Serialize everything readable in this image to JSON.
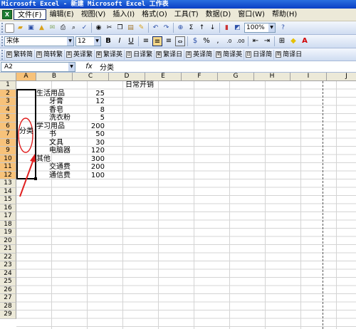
{
  "window": {
    "title": "Microsoft Excel - 新建 Microsoft Excel 工作表"
  },
  "menu": {
    "app_icon": "excel-icon",
    "items": [
      "文件(F)",
      "编辑(E)",
      "视图(V)",
      "插入(I)",
      "格式(O)",
      "工具(T)",
      "数据(D)",
      "窗口(W)",
      "帮助(H)"
    ]
  },
  "toolbar": {
    "zoom": "100%",
    "sum_icon": "Σ"
  },
  "format_toolbar": {
    "font": "宋体",
    "size": "12",
    "bold": "B",
    "italic": "I",
    "underline": "U",
    "percent": "%"
  },
  "translate_toolbar": {
    "items": [
      "繁转简",
      "简转繁",
      "英译繁",
      "繁译英",
      "日译繁",
      "繁译日",
      "英译简",
      "简译英",
      "日译简",
      "简译日"
    ]
  },
  "formula_bar": {
    "name_box": "A2",
    "fx": "fx",
    "value": "分类"
  },
  "grid": {
    "columns": [
      "A",
      "B",
      "C",
      "D",
      "E",
      "F",
      "G",
      "H",
      "I",
      "J"
    ],
    "rows": [
      "1",
      "2",
      "3",
      "4",
      "5",
      "6",
      "7",
      "8",
      "9",
      "10",
      "11",
      "12",
      "13",
      "14",
      "15",
      "16",
      "17",
      "18",
      "19",
      "20",
      "21",
      "22",
      "23",
      "24",
      "25",
      "26",
      "27",
      "28",
      "29"
    ],
    "selected_col": "A",
    "selected_rows": [
      "2",
      "3",
      "4",
      "5",
      "6",
      "7",
      "8",
      "9",
      "10",
      "11",
      "12"
    ]
  },
  "sheet": {
    "header": "日常开销",
    "merged_a": "分类",
    "cells": [
      {
        "label": "生活用品",
        "value": "25",
        "indent": false
      },
      {
        "label": "牙膏",
        "value": "12",
        "indent": true
      },
      {
        "label": "香皂",
        "value": "8",
        "indent": true
      },
      {
        "label": "洗衣粉",
        "value": "5",
        "indent": true
      },
      {
        "label": "学习用品",
        "value": "200",
        "indent": false
      },
      {
        "label": "书",
        "value": "50",
        "indent": true
      },
      {
        "label": "文具",
        "value": "30",
        "indent": true
      },
      {
        "label": "电脑器",
        "value": "120",
        "indent": true
      },
      {
        "label": "其他",
        "value": "300",
        "indent": false
      },
      {
        "label": "交通费",
        "value": "200",
        "indent": true
      },
      {
        "label": "通信费",
        "value": "100",
        "indent": true
      }
    ]
  },
  "annotation": {
    "color": "#e02020"
  }
}
